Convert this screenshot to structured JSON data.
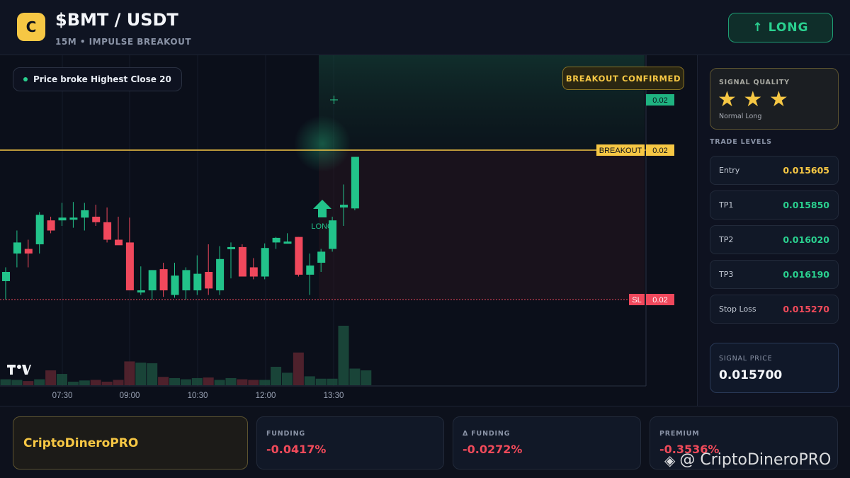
{
  "header": {
    "logo_letter": "C",
    "title": "$BMT / USDT",
    "subtitle": "15M • IMPULSE BREAKOUT",
    "long_button": "↑ LONG"
  },
  "chart": {
    "chip_text": "Price broke Highest Close 20",
    "confirmed_badge": "BREAKOUT CONFIRMED",
    "top_price_tag": "0.02",
    "breakout_label": "BREAKOUT",
    "breakout_price": "0.02",
    "sl_label": "SL",
    "sl_price": "0.02",
    "arrow_label": "LONG",
    "tv_logo": "TV",
    "time_labels": [
      "07:30",
      "09:00",
      "10:30",
      "12:00",
      "13:30"
    ],
    "colors": {
      "up": "#22c38a",
      "down": "#f0485c",
      "breakout": "#f6c744",
      "sl": "#f0485c"
    }
  },
  "chart_data": {
    "type": "candlestick",
    "x": [
      "07:30",
      "09:00",
      "10:30",
      "12:00",
      "13:30"
    ],
    "candles": [
      {
        "o": 0.2,
        "h": 0.35,
        "l": 0.0,
        "c": 0.3
      },
      {
        "o": 0.5,
        "h": 0.75,
        "l": 0.35,
        "c": 0.62
      },
      {
        "o": 0.55,
        "h": 0.65,
        "l": 0.35,
        "c": 0.5
      },
      {
        "o": 0.6,
        "h": 0.95,
        "l": 0.5,
        "c": 0.92
      },
      {
        "o": 0.86,
        "h": 0.9,
        "l": 0.72,
        "c": 0.75
      },
      {
        "o": 0.86,
        "h": 1.05,
        "l": 0.8,
        "c": 0.89
      },
      {
        "o": 0.89,
        "h": 1.06,
        "l": 0.78,
        "c": 0.89
      },
      {
        "o": 0.89,
        "h": 1.05,
        "l": 0.75,
        "c": 0.97
      },
      {
        "o": 0.9,
        "h": 1.03,
        "l": 0.8,
        "c": 0.84
      },
      {
        "o": 0.84,
        "h": 1.0,
        "l": 0.62,
        "c": 0.65
      },
      {
        "o": 0.65,
        "h": 0.9,
        "l": 0.6,
        "c": 0.59
      },
      {
        "o": 0.62,
        "h": 0.89,
        "l": 0.1,
        "c": 0.1
      },
      {
        "o": 0.1,
        "h": 0.36,
        "l": 0.05,
        "c": 0.1
      },
      {
        "o": 0.1,
        "h": 0.32,
        "l": 0.0,
        "c": 0.32
      },
      {
        "o": 0.33,
        "h": 0.4,
        "l": 0.03,
        "c": 0.1
      },
      {
        "o": 0.05,
        "h": 0.4,
        "l": 0.02,
        "c": 0.26
      },
      {
        "o": 0.1,
        "h": 0.35,
        "l": 0.0,
        "c": 0.32
      },
      {
        "o": 0.1,
        "h": 0.48,
        "l": 0.05,
        "c": 0.28
      },
      {
        "o": 0.3,
        "h": 0.6,
        "l": 0.05,
        "c": 0.12
      },
      {
        "o": 0.1,
        "h": 0.58,
        "l": 0.05,
        "c": 0.44
      },
      {
        "o": 0.57,
        "h": 0.62,
        "l": 0.23,
        "c": 0.57
      },
      {
        "o": 0.57,
        "h": 0.6,
        "l": 0.25,
        "c": 0.25
      },
      {
        "o": 0.35,
        "h": 0.45,
        "l": 0.22,
        "c": 0.25
      },
      {
        "o": 0.25,
        "h": 0.61,
        "l": 0.22,
        "c": 0.56
      },
      {
        "o": 0.62,
        "h": 0.68,
        "l": 0.55,
        "c": 0.67
      },
      {
        "o": 0.63,
        "h": 0.72,
        "l": 0.62,
        "c": 0.63
      },
      {
        "o": 0.68,
        "h": 0.68,
        "l": 0.25,
        "c": 0.27
      },
      {
        "o": 0.27,
        "h": 0.5,
        "l": 0.05,
        "c": 0.37
      },
      {
        "o": 0.4,
        "h": 0.55,
        "l": 0.3,
        "c": 0.52
      },
      {
        "o": 0.55,
        "h": 0.9,
        "l": 0.52,
        "c": 0.86
      },
      {
        "o": 1.0,
        "h": 1.25,
        "l": 0.8,
        "c": 1.03
      },
      {
        "o": 0.99,
        "h": 1.34,
        "l": 0.97,
        "c": 1.55
      }
    ],
    "volumes": [
      0.1,
      0.09,
      0.07,
      0.1,
      0.25,
      0.19,
      0.06,
      0.08,
      0.09,
      0.06,
      0.09,
      0.4,
      0.38,
      0.37,
      0.14,
      0.12,
      0.1,
      0.12,
      0.13,
      0.09,
      0.12,
      0.1,
      0.09,
      0.09,
      0.31,
      0.21,
      0.55,
      0.15,
      0.11,
      0.11,
      1.0,
      0.28,
      0.25
    ],
    "breakout_level": 0.02,
    "stop_loss_level": 0.02,
    "signal_arrow": "LONG"
  },
  "panel": {
    "quality_label": "SIGNAL QUALITY",
    "stars": "★ ★ ★",
    "quality_sub": "Normal Long",
    "trade_levels_title": "TRADE LEVELS",
    "levels": [
      {
        "name": "Entry",
        "value": "0.015605",
        "color": "#f6c744"
      },
      {
        "name": "TP1",
        "value": "0.015850",
        "color": "#2ad08f"
      },
      {
        "name": "TP2",
        "value": "0.016020",
        "color": "#2ad08f"
      },
      {
        "name": "TP3",
        "value": "0.016190",
        "color": "#2ad08f"
      },
      {
        "name": "Stop Loss",
        "value": "0.015270",
        "color": "#f04a5a"
      }
    ],
    "signal_price_label": "SIGNAL PRICE",
    "signal_price": "0.015700"
  },
  "footer": {
    "brand": "CriptoDineroPRO",
    "stats": [
      {
        "label": "FUNDING",
        "value": "-0.0417%"
      },
      {
        "label": "Δ FUNDING",
        "value": "-0.0272%"
      },
      {
        "label": "PREMIUM",
        "value": "-0.3536%"
      }
    ],
    "watermark": "@ CriptoDineroPRO"
  }
}
